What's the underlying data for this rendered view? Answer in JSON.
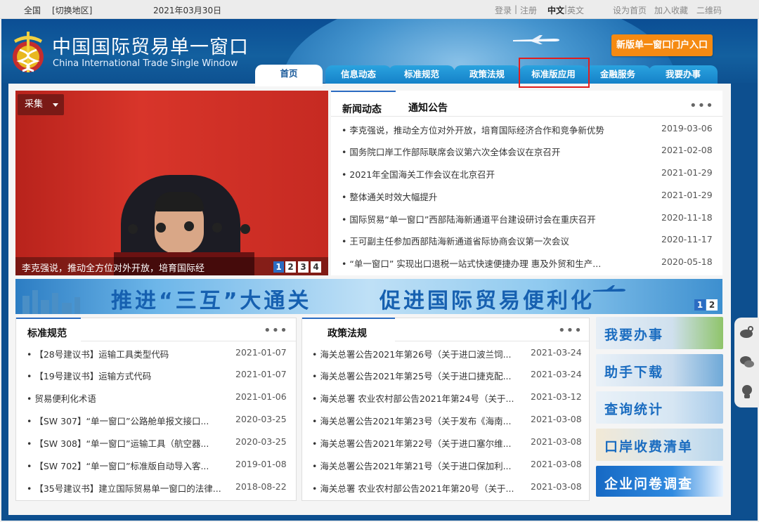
{
  "topbar": {
    "region": "全国",
    "switch_region": "[切换地区]",
    "date": "2021年03月30日",
    "login": "登录",
    "sep1": "|",
    "register": "注册",
    "lang_cn": "中文",
    "sep2": "|",
    "lang_en": "英文",
    "set_home": "设为首页",
    "bookmark": "加入收藏",
    "qrcode": "二维码"
  },
  "header": {
    "title_cn": "中国国际贸易单一窗口",
    "title_en": "China International Trade Single Window",
    "portal_button": "新版单一窗口门户入口"
  },
  "nav": {
    "tabs": [
      "首页",
      "信息动态",
      "标准规范",
      "政策法规",
      "标准版应用",
      "金融服务",
      "我要办事"
    ],
    "active_index": 0,
    "highlighted_index": 4
  },
  "slideshow": {
    "collect_button": "采集",
    "caption": "李克强说，推动全方位对外开放，培育国际经",
    "pages": [
      "1",
      "2",
      "3",
      "4"
    ],
    "active_page": 0
  },
  "news": {
    "tabs": [
      "新闻动态",
      "通知公告"
    ],
    "more": "•••",
    "items": [
      {
        "title": "李克强说，推动全方位对外开放，培育国际经济合作和竞争新优势",
        "date": "2019-03-06"
      },
      {
        "title": "国务院口岸工作部际联席会议第六次全体会议在京召开",
        "date": "2021-02-08"
      },
      {
        "title": "2021年全国海关工作会议在北京召开",
        "date": "2021-01-29"
      },
      {
        "title": "整体通关时效大幅提升",
        "date": "2021-01-29"
      },
      {
        "title": "国际贸易“单一窗口”西部陆海新通道平台建设研讨会在重庆召开",
        "date": "2020-11-18"
      },
      {
        "title": "王可副主任参加西部陆海新通道省际协商会议第一次会议",
        "date": "2020-11-17"
      },
      {
        "title": "“单一窗口” 实现出口退税一站式快速便捷办理 惠及外贸和生产...",
        "date": "2020-05-18"
      }
    ]
  },
  "banner": {
    "text_left": "推进“三互”大通关",
    "text_right": "促进国际贸易便利化",
    "pages": [
      "1",
      "2"
    ],
    "active_page": 0
  },
  "standards": {
    "title": "标准规范",
    "more": "•••",
    "items": [
      {
        "title": "【28号建议书】运输工具类型代码",
        "date": "2021-01-07"
      },
      {
        "title": "【19号建议书】运输方式代码",
        "date": "2021-01-07"
      },
      {
        "title": "贸易便利化术语",
        "date": "2021-01-06"
      },
      {
        "title": "【SW 307】“单一窗口”公路舱单报文接口...",
        "date": "2020-03-25"
      },
      {
        "title": "【SW 308】“单一窗口”运输工具（航空器...",
        "date": "2020-03-25"
      },
      {
        "title": "【SW 702】“单一窗口”标准版自动导入客...",
        "date": "2019-01-08"
      },
      {
        "title": "【35号建议书】建立国际贸易单一窗口的法律...",
        "date": "2018-08-22"
      }
    ]
  },
  "policies": {
    "title": "政策法规",
    "more": "•••",
    "items": [
      {
        "title": "海关总署公告2021年第26号（关于进口波兰饲...",
        "date": "2021-03-24"
      },
      {
        "title": "海关总署公告2021年第25号（关于进口捷克配...",
        "date": "2021-03-24"
      },
      {
        "title": "海关总署 农业农村部公告2021年第24号（关于...",
        "date": "2021-03-12"
      },
      {
        "title": "海关总署公告2021年第23号（关于发布《海南...",
        "date": "2021-03-08"
      },
      {
        "title": "海关总署公告2021年第22号（关于进口塞尔维...",
        "date": "2021-03-08"
      },
      {
        "title": "海关总署公告2021年第21号（关于进口保加利...",
        "date": "2021-03-08"
      },
      {
        "title": "海关总署 农业农村部公告2021年第20号（关于...",
        "date": "2021-03-08"
      }
    ]
  },
  "side_cards": [
    {
      "label": "我要办事",
      "color": "#1a6cc0"
    },
    {
      "label": "助手下载",
      "color": "#1a6cc0"
    },
    {
      "label": "查询统计",
      "color": "#1a6cc0"
    },
    {
      "label": "口岸收费清单",
      "color": "#1a6cc0"
    },
    {
      "label": "企业问卷调查",
      "color": "#ffffff"
    }
  ],
  "colors": {
    "header_blue": "#0d4f8f",
    "tab_blue": "#1581c8",
    "accent_orange": "#f58a12",
    "highlight_red": "#e21d1d",
    "active_blue": "#2b6cc2"
  }
}
